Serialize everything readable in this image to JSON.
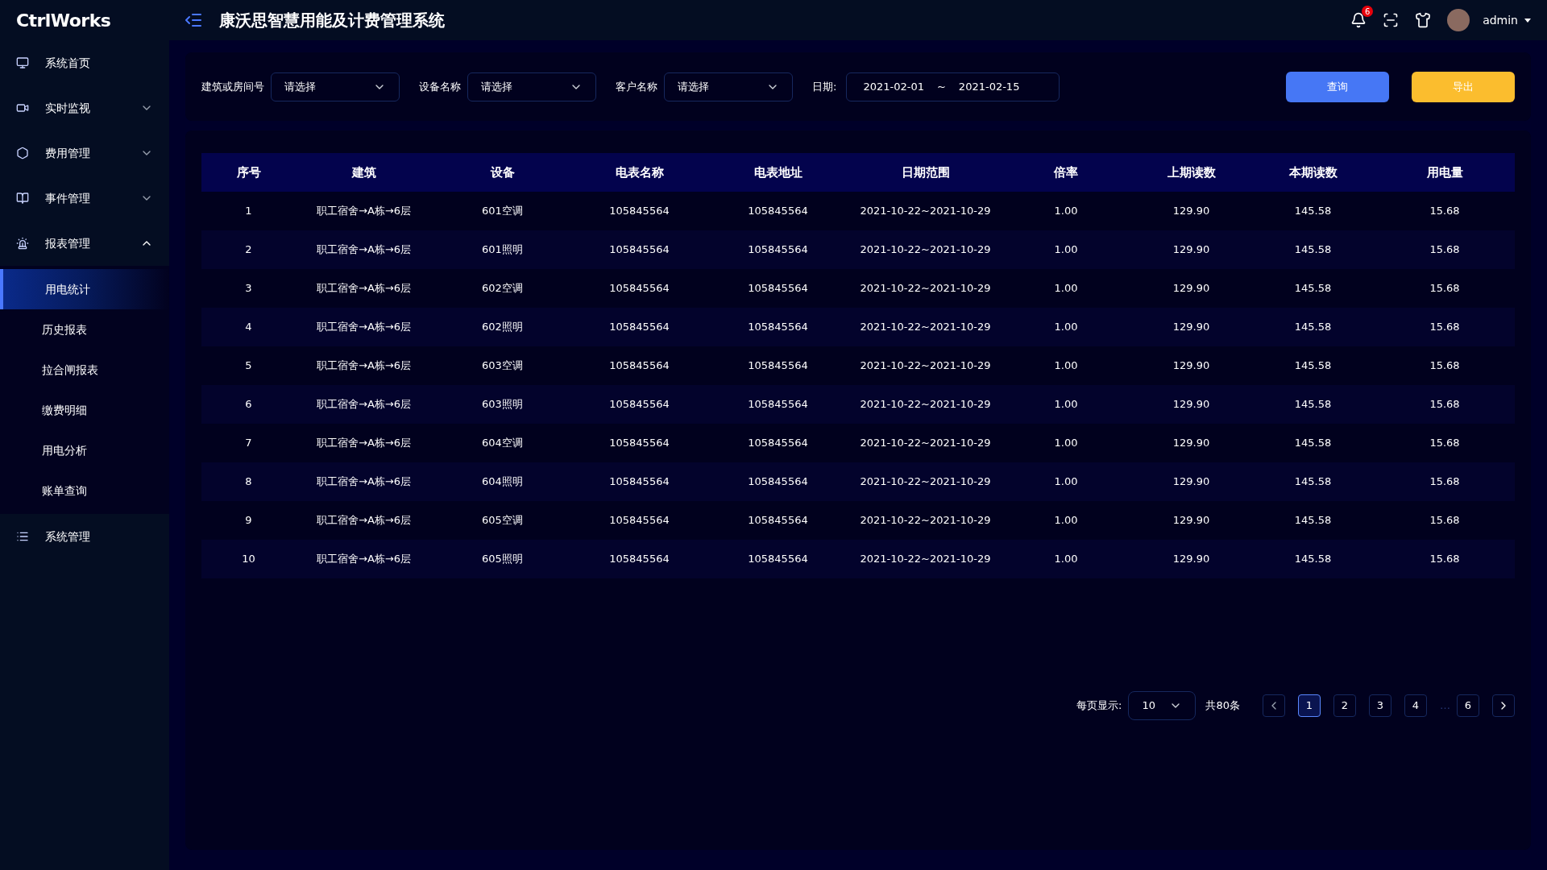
{
  "header": {
    "logo": "CtrlWorks",
    "title": "康沃思智慧用能及计费管理系统",
    "notification_count": "6",
    "user": "admin"
  },
  "sidebar": {
    "items": [
      {
        "label": "系统首页"
      },
      {
        "label": "实时监视",
        "expanded": false
      },
      {
        "label": "费用管理",
        "expanded": false
      },
      {
        "label": "事件管理",
        "expanded": false
      },
      {
        "label": "报表管理",
        "expanded": true,
        "children": [
          {
            "label": "用电统计",
            "selected": true
          },
          {
            "label": "历史报表",
            "selected": false
          },
          {
            "label": "拉合闸报表",
            "selected": false
          },
          {
            "label": "缴费明细",
            "selected": false
          },
          {
            "label": "用电分析",
            "selected": false
          },
          {
            "label": "账单查询",
            "selected": false
          }
        ]
      },
      {
        "label": "系统管理"
      }
    ]
  },
  "filters": [
    {
      "label": "建筑或房间号",
      "placeholder": "请选择"
    },
    {
      "label": "设备名称",
      "placeholder": "请选择"
    },
    {
      "label": "客户名称",
      "placeholder": "请选择"
    }
  ],
  "date_filter": {
    "label": "日期:",
    "start": "2021-02-01",
    "separator": "~",
    "end": "2021-02-15"
  },
  "buttons": [
    {
      "label": "查询",
      "kind": "primary"
    },
    {
      "label": "导出",
      "kind": "warning"
    }
  ],
  "table": {
    "columns": [
      "序号",
      "建筑",
      "设备",
      "电表名称",
      "电表地址",
      "日期范围",
      "倍率",
      "上期读数",
      "本期读数",
      "用电量"
    ],
    "rows": [
      [
        "1",
        "职工宿舍→A栋→6层",
        "601空调",
        "105845564",
        "105845564",
        "2021-10-22~2021-10-29",
        "1.00",
        "129.90",
        "145.58",
        "15.68"
      ],
      [
        "2",
        "职工宿舍→A栋→6层",
        "601照明",
        "105845564",
        "105845564",
        "2021-10-22~2021-10-29",
        "1.00",
        "129.90",
        "145.58",
        "15.68"
      ],
      [
        "3",
        "职工宿舍→A栋→6层",
        "602空调",
        "105845564",
        "105845564",
        "2021-10-22~2021-10-29",
        "1.00",
        "129.90",
        "145.58",
        "15.68"
      ],
      [
        "4",
        "职工宿舍→A栋→6层",
        "602照明",
        "105845564",
        "105845564",
        "2021-10-22~2021-10-29",
        "1.00",
        "129.90",
        "145.58",
        "15.68"
      ],
      [
        "5",
        "职工宿舍→A栋→6层",
        "603空调",
        "105845564",
        "105845564",
        "2021-10-22~2021-10-29",
        "1.00",
        "129.90",
        "145.58",
        "15.68"
      ],
      [
        "6",
        "职工宿舍→A栋→6层",
        "603照明",
        "105845564",
        "105845564",
        "2021-10-22~2021-10-29",
        "1.00",
        "129.90",
        "145.58",
        "15.68"
      ],
      [
        "7",
        "职工宿舍→A栋→6层",
        "604空调",
        "105845564",
        "105845564",
        "2021-10-22~2021-10-29",
        "1.00",
        "129.90",
        "145.58",
        "15.68"
      ],
      [
        "8",
        "职工宿舍→A栋→6层",
        "604照明",
        "105845564",
        "105845564",
        "2021-10-22~2021-10-29",
        "1.00",
        "129.90",
        "145.58",
        "15.68"
      ],
      [
        "9",
        "职工宿舍→A栋→6层",
        "605空调",
        "105845564",
        "105845564",
        "2021-10-22~2021-10-29",
        "1.00",
        "129.90",
        "145.58",
        "15.68"
      ],
      [
        "10",
        "职工宿舍→A栋→6层",
        "605照明",
        "105845564",
        "105845564",
        "2021-10-22~2021-10-29",
        "1.00",
        "129.90",
        "145.58",
        "15.68"
      ]
    ]
  },
  "pagination": {
    "page_size_label": "每页显示:",
    "page_size": "10",
    "total": "共80条",
    "pages": [
      {
        "label": "1",
        "selected": true
      },
      {
        "label": "2",
        "selected": false
      },
      {
        "label": "3",
        "selected": false
      },
      {
        "label": "4",
        "selected": false
      },
      {
        "label": "…",
        "kind": "ellipsis"
      },
      {
        "label": "6",
        "selected": false
      }
    ]
  }
}
